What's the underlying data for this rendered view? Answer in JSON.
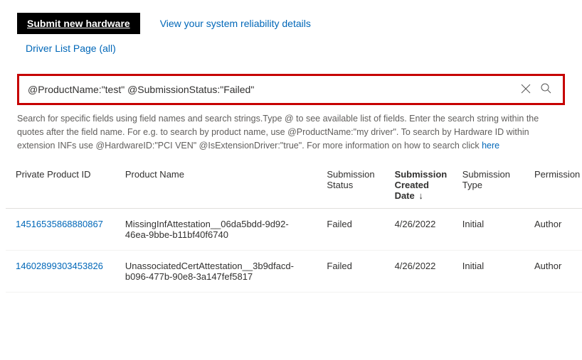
{
  "topbar": {
    "submit_label": "Submit new hardware",
    "reliability_link": "View your system reliability details"
  },
  "subnav": {
    "driver_list_label": "Driver List Page (all)"
  },
  "search": {
    "value": "@ProductName:\"test\" @SubmissionStatus:\"Failed\""
  },
  "help": {
    "text": "Search for specific fields using field names and search strings.Type @ to see available list of fields. Enter the search string within the quotes after the field name. For e.g. to search by product name, use @ProductName:\"my driver\". To search by Hardware ID within extension INFs use @HardwareID:\"PCI VEN\" @IsExtensionDriver:\"true\". For more information on how to search click ",
    "here": "here"
  },
  "table": {
    "headers": {
      "id": "Private Product ID",
      "name": "Product Name",
      "status": "Submission Status",
      "date": "Submission Created Date",
      "type": "Submission Type",
      "perm": "Permission"
    },
    "sort_indicator": "↓",
    "rows": [
      {
        "id": "14516535868880867",
        "name": "MissingInfAttestation__06da5bdd-9d92-46ea-9bbe-b11bf40f6740",
        "status": "Failed",
        "date": "4/26/2022",
        "type": "Initial",
        "perm": "Author"
      },
      {
        "id": "14602899303453826",
        "name": "UnassociatedCertAttestation__3b9dfacd-b096-477b-90e8-3a147fef5817",
        "status": "Failed",
        "date": "4/26/2022",
        "type": "Initial",
        "perm": "Author"
      }
    ]
  }
}
